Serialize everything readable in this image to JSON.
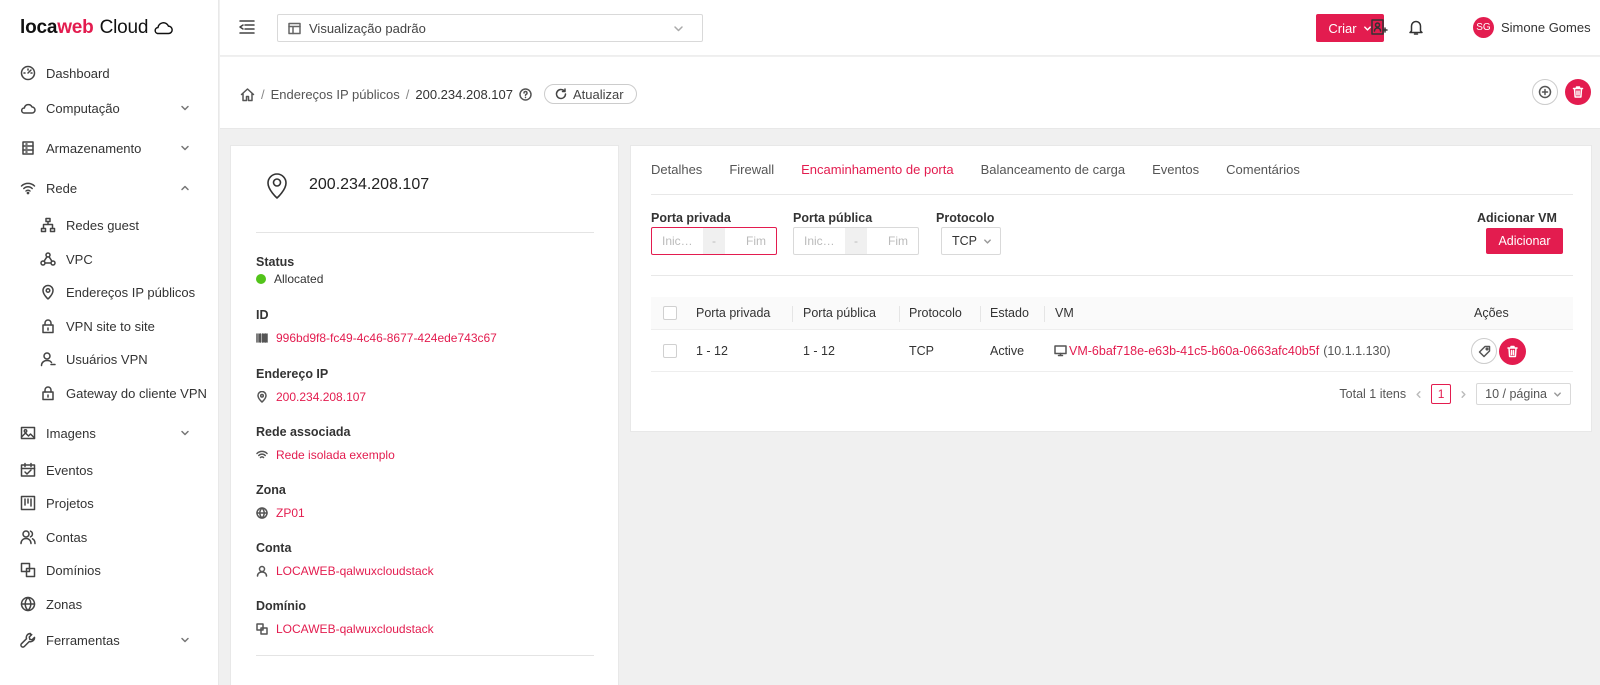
{
  "brand": {
    "part1": "loca",
    "part2": "web",
    "part3": "Cloud"
  },
  "sidebar": {
    "items": [
      {
        "label": "Dashboard",
        "icon": "dashboard-icon"
      },
      {
        "label": "Computação",
        "icon": "cloud-icon"
      },
      {
        "label": "Armazenamento",
        "icon": "storage-icon"
      },
      {
        "label": "Rede",
        "icon": "wifi-icon"
      },
      {
        "label": "Redes guest",
        "icon": "network-icon"
      },
      {
        "label": "VPC",
        "icon": "vpc-icon"
      },
      {
        "label": "Endereços IP públicos",
        "icon": "location-pin-icon"
      },
      {
        "label": "VPN site to site",
        "icon": "lock-icon"
      },
      {
        "label": "Usuários VPN",
        "icon": "user-icon"
      },
      {
        "label": "Gateway do cliente VPN",
        "icon": "lock-icon"
      },
      {
        "label": "Imagens",
        "icon": "image-icon"
      },
      {
        "label": "Eventos",
        "icon": "calendar-icon"
      },
      {
        "label": "Projetos",
        "icon": "project-icon"
      },
      {
        "label": "Contas",
        "icon": "users-icon"
      },
      {
        "label": "Domínios",
        "icon": "domain-icon"
      },
      {
        "label": "Zonas",
        "icon": "globe-icon"
      },
      {
        "label": "Ferramentas",
        "icon": "wrench-icon"
      }
    ]
  },
  "header": {
    "view_select": "Visualização padrão",
    "create_label": "Criar",
    "user_initials": "SG",
    "user_name": "Simone Gomes"
  },
  "breadcrumb": {
    "parent": "Endereços IP públicos",
    "current": "200.234.208.107",
    "refresh_label": "Atualizar"
  },
  "details": {
    "ip": "200.234.208.107",
    "status_label": "Status",
    "status_value": "Allocated",
    "id_label": "ID",
    "id_value": "996bd9f8-fc49-4c46-8677-424ede743c67",
    "address_label": "Endereço IP",
    "address_value": "200.234.208.107",
    "network_label": "Rede associada",
    "network_value": "Rede isolada exemplo",
    "zone_label": "Zona",
    "zone_value": "ZP01",
    "account_label": "Conta",
    "account_value": "LOCAWEB-qalwuxcloudstack",
    "domain_label": "Domínio",
    "domain_value": "LOCAWEB-qalwuxcloudstack"
  },
  "tabs": [
    "Detalhes",
    "Firewall",
    "Encaminhamento de porta",
    "Balanceamento de carga",
    "Eventos",
    "Comentários"
  ],
  "form": {
    "private_port_label": "Porta privada",
    "public_port_label": "Porta pública",
    "protocol_label": "Protocolo",
    "start_placeholder": "Inic…",
    "end_placeholder": "Fim",
    "range_sep": "-",
    "protocol_value": "TCP",
    "add_vm_label": "Adicionar VM",
    "add_button": "Adicionar"
  },
  "table": {
    "columns": [
      "Porta privada",
      "Porta pública",
      "Protocolo",
      "Estado",
      "VM",
      "Ações"
    ],
    "rows": [
      {
        "private": "1 - 12",
        "public": "1 - 12",
        "protocol": "TCP",
        "state": "Active",
        "vm": "VM-6baf718e-e63b-41c5-b60a-0663afc40b5f",
        "vm_ip": "(10.1.1.130)"
      }
    ]
  },
  "pagination": {
    "total": "Total 1 itens",
    "page": "1",
    "page_size": "10 / página"
  },
  "colors": {
    "accent": "#e31c4f",
    "status_ok": "#52c41a"
  }
}
